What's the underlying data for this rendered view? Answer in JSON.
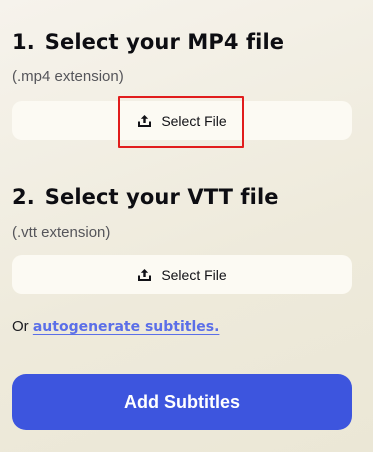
{
  "step1": {
    "number": "1.",
    "title": "Select your MP4 file",
    "hint": "(.mp4 extension)",
    "button_label": "Select File",
    "button_icon": "upload-icon"
  },
  "step2": {
    "number": "2.",
    "title": "Select your VTT file",
    "hint": "(.vtt extension)",
    "button_label": "Select File",
    "button_icon": "upload-icon"
  },
  "alt": {
    "prefix": "Or",
    "link_text": "autogenerate subtitles."
  },
  "submit": {
    "label": "Add Subtitles"
  },
  "colors": {
    "accent": "#3d55de",
    "link": "#5b6fe8",
    "highlight": "#e11d1d"
  }
}
